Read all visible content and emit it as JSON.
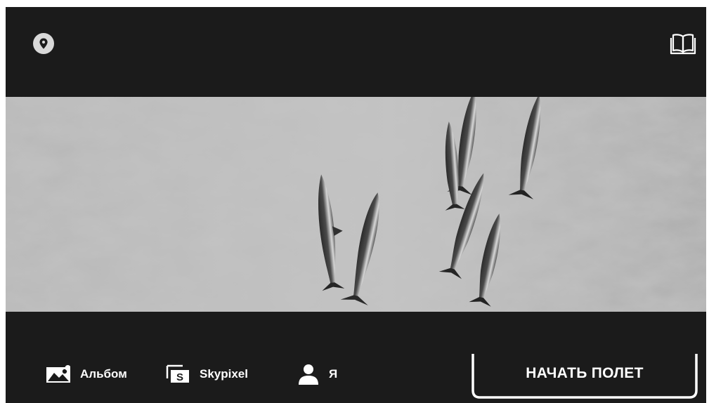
{
  "top_bar": {
    "map_icon": "location-pin-icon",
    "guide_icon": "book-icon"
  },
  "banner": {
    "description_icon": "hero-image"
  },
  "bottom_nav": {
    "album_label": "Альбом",
    "album_icon": "image-icon",
    "skypixel_label": "Skypixel",
    "skypixel_icon": "skypixel-icon",
    "me_label": "Я",
    "me_icon": "user-icon"
  },
  "start_button": {
    "label": "НАЧАТЬ ПОЛЕТ"
  },
  "colors": {
    "background": "#1b1b1b",
    "text": "#ffffff",
    "map_icon": "#d9d9d9"
  }
}
